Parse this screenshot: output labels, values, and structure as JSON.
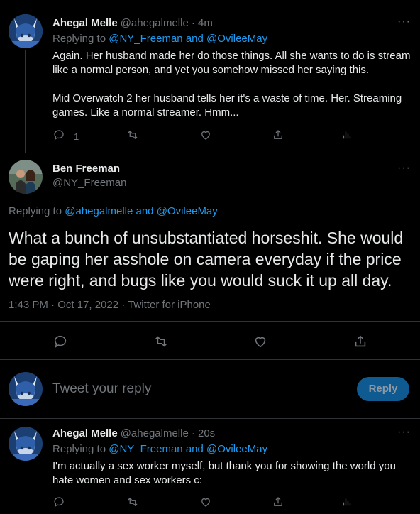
{
  "tweet1": {
    "name": "Ahegal Melle",
    "handle": "@ahegalmelle",
    "time": "· 4m",
    "replying_label": "Replying to",
    "replying_users": "@NY_Freeman and @OvileeMay",
    "text": "Again. Her husband made her do those things. All she wants to do is stream\nlike a normal person, and yet you somehow missed her saying this.\n\nMid Overwatch 2 her husband tells her it's a waste of time. Her. Streaming\ngames. Like a normal streamer. Hmm...",
    "reply_count": "1"
  },
  "main_tweet": {
    "name": "Ben Freeman",
    "handle": "@NY_Freeman",
    "replying_label": "Replying to",
    "replying_users": "@ahegalmelle and @OvileeMay",
    "text": "What a bunch of unsubstantiated horseshit. She would be gaping her asshole on camera everyday if the price were right, and bugs like you would suck it up all day.",
    "timestamp": "1:43 PM · Oct 17, 2022 · Twitter for iPhone"
  },
  "composer": {
    "placeholder": "Tweet your reply",
    "button_label": "Reply"
  },
  "tweet3": {
    "name": "Ahegal Melle",
    "handle": "@ahegalmelle",
    "time": "· 20s",
    "replying_label": "Replying to",
    "replying_users": "@NY_Freeman and @OvileeMay",
    "text": "I'm actually a sex worker myself, but thank you for showing the world you\nhate women and sex workers c:"
  },
  "colors": {
    "background": "#000000",
    "text": "#e7e9ea",
    "secondary": "#71767b",
    "accent": "#1d9bf0",
    "divider": "#2f3336"
  },
  "icons": [
    "more-icon",
    "reply-icon",
    "retweet-icon",
    "like-icon",
    "share-icon",
    "analytics-icon"
  ]
}
